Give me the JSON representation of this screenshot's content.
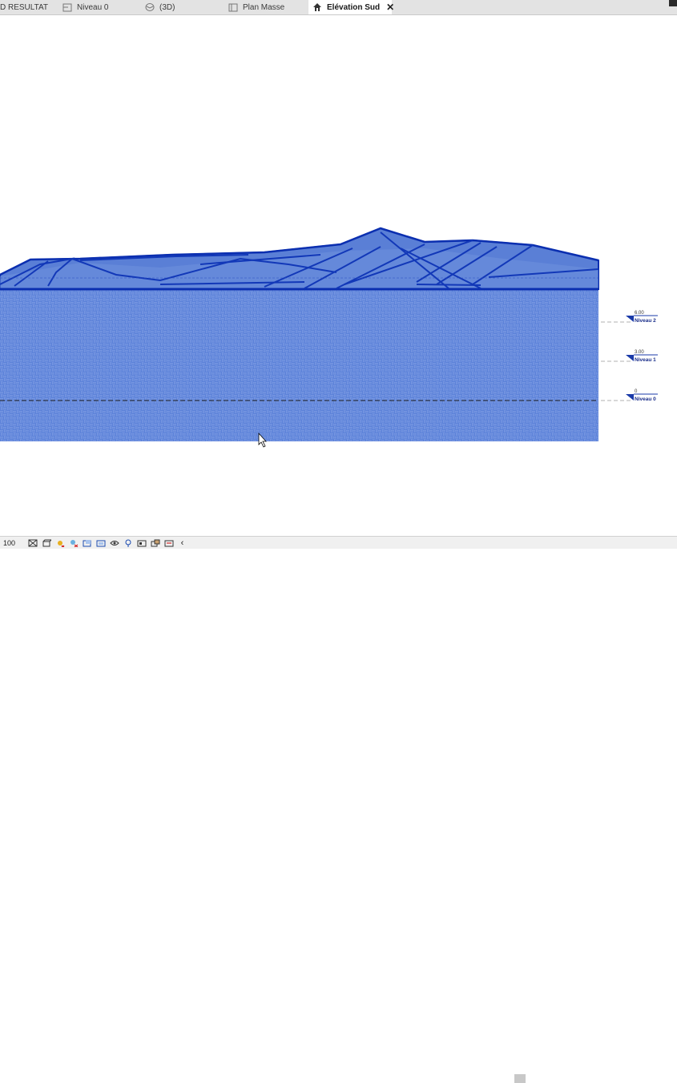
{
  "tabs": [
    {
      "label": "D RESULTAT",
      "icon": "none",
      "active": false
    },
    {
      "label": "Niveau 0",
      "icon": "floor-plan-icon",
      "active": false
    },
    {
      "label": "(3D)",
      "icon": "3d-view-icon",
      "active": false
    },
    {
      "label": "Plan Masse",
      "icon": "site-plan-icon",
      "active": false
    },
    {
      "label": "Elévation Sud",
      "icon": "elevation-icon",
      "active": true
    }
  ],
  "levels": [
    {
      "elevation": "6.00",
      "name": "Niveau 2"
    },
    {
      "elevation": "3.00",
      "name": "Niveau 1"
    },
    {
      "elevation": "0",
      "name": "Niveau 0"
    }
  ],
  "statusbar": {
    "scale": "100",
    "icons": [
      "detail-level-icon",
      "visual-style-icon",
      "sun-path-icon",
      "shadows-icon",
      "crop-view-icon",
      "show-crop-icon",
      "temporary-hide-icon",
      "reveal-hidden-icon",
      "design-options-icon",
      "analytical-model-icon",
      "constraints-icon",
      "worksharing-icon",
      "collapse-chevron-icon"
    ]
  },
  "colors": {
    "terrain_fill": "#5c82d9",
    "terrain_edge": "#0b2fb0",
    "roof_fill": "#5a7fd6",
    "level_marker": "#1a3aa8"
  }
}
